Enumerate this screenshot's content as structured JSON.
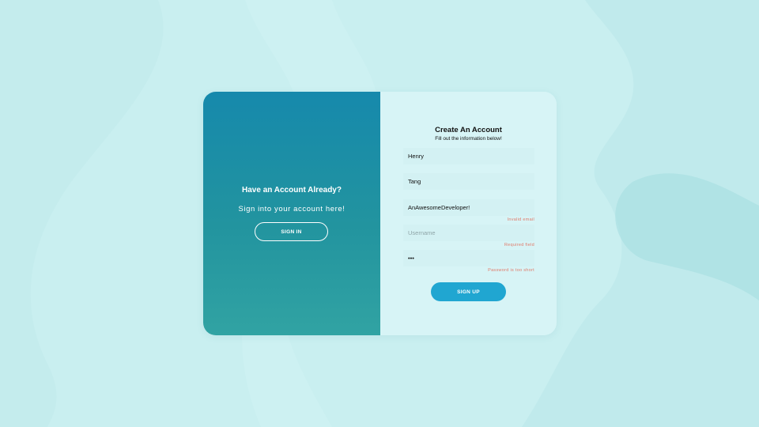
{
  "signin_panel": {
    "title": "Have an Account Already?",
    "subtitle": "Sign into your account here!",
    "signin_label": "SIGN IN"
  },
  "signup_panel": {
    "title": "Create An Account",
    "subtitle": "Fill out the information below!",
    "fields": {
      "first_name": {
        "value": "Henry"
      },
      "last_name": {
        "value": "Tang"
      },
      "email": {
        "value": "AnAwesomeDeveloper!",
        "error": "Invalid email"
      },
      "username": {
        "value": "",
        "placeholder": "Username",
        "error": "Required field"
      },
      "password": {
        "value": "•••",
        "error": "Password is too short"
      }
    },
    "signup_label": "SIGN UP"
  },
  "colors": {
    "background": "#c9eff0",
    "left_panel_top": "#1689ac",
    "left_panel_bottom": "#31a3a3",
    "signup_button": "#20a6d1",
    "error_text": "#e07a6a"
  }
}
